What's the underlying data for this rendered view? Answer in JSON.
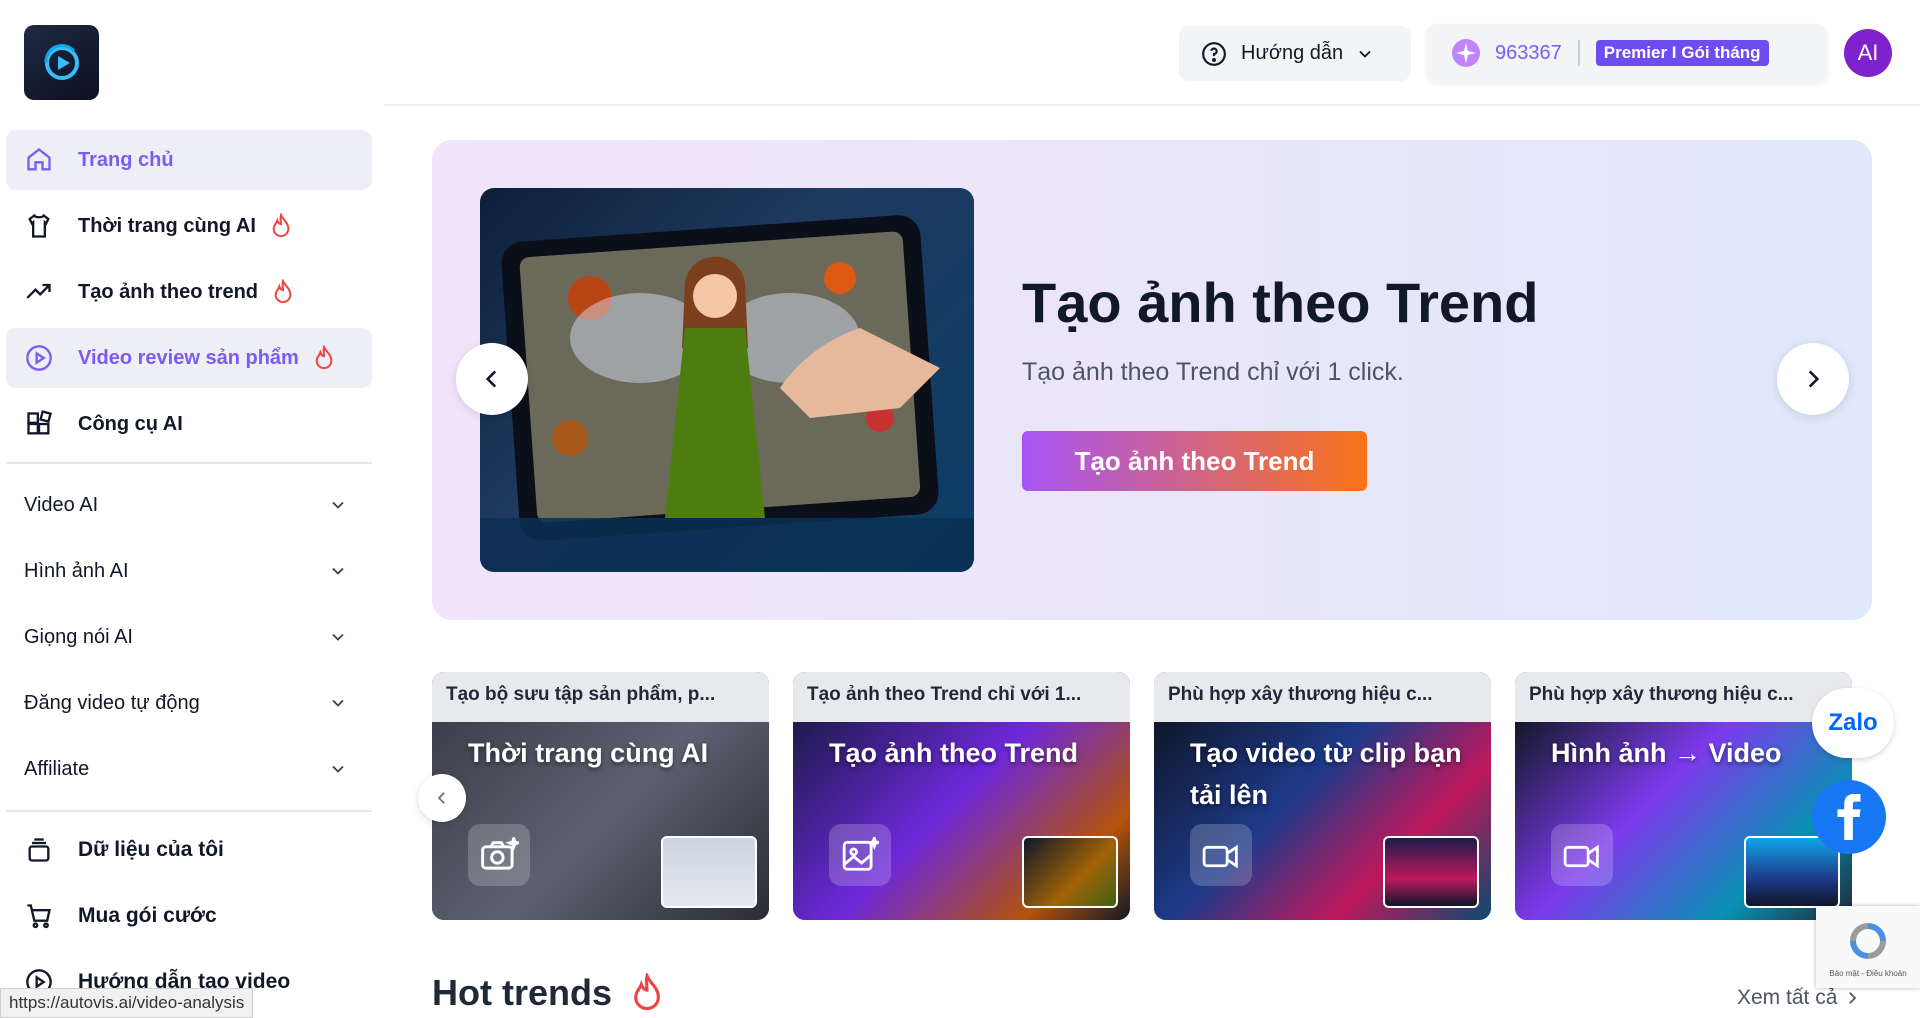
{
  "sidebar": {
    "nav": [
      {
        "label": "Trang chủ",
        "icon": "home-icon",
        "active": true
      },
      {
        "label": "Thời trang cùng AI",
        "icon": "shirt-icon",
        "hot": true
      },
      {
        "label": "Tạo ảnh theo trend",
        "icon": "trend-icon",
        "hot": true
      },
      {
        "label": "Video review sản phẩm",
        "icon": "play-circle-icon",
        "hot": true,
        "active": true
      },
      {
        "label": "Công cụ AI",
        "icon": "tools-icon"
      }
    ],
    "groups": [
      "Video AI",
      "Hình ảnh AI",
      "Giọng nói AI",
      "Đăng video tự động",
      "Affiliate"
    ],
    "bottom": [
      {
        "label": "Dữ liệu của tôi",
        "icon": "layers-icon"
      },
      {
        "label": "Mua gói cước",
        "icon": "cart-icon"
      },
      {
        "label": "Hướng dẫn tạo video",
        "icon": "play-circle-icon"
      }
    ]
  },
  "header": {
    "guide_label": "Hướng dẫn",
    "credits": "963367",
    "plan": "Premier  I  Gói tháng",
    "avatar": "AI"
  },
  "hero": {
    "title": "Tạo ảnh theo Trend",
    "subtitle": "Tạo ảnh theo Trend chỉ với 1 click.",
    "cta": "Tạo ảnh theo Trend"
  },
  "cards": [
    {
      "caption": "Tạo bộ sưu tập sản phẩm, p...",
      "title": "Thời trang cùng AI",
      "icon": "camera-sparkle-icon"
    },
    {
      "caption": "Tạo ảnh theo Trend chỉ với 1...",
      "title": "Tạo ảnh theo Trend",
      "icon": "image-sparkle-icon"
    },
    {
      "caption": "Phù hợp xây thương hiệu c...",
      "title": "Tạo video từ clip bạn tải lên",
      "icon": "video-icon"
    },
    {
      "caption": "Phù hợp xây thương hiệu c...",
      "title": "Hình ảnh → Video",
      "icon": "video-icon"
    }
  ],
  "hot_trends": {
    "title": "Hot trends",
    "see_all": "Xem tất cả"
  },
  "floating": {
    "zalo": "Zalo",
    "recaptcha": "Bảo mật - Điều khoản"
  },
  "status_url": "https://autovis.ai/video-analysis",
  "colors": {
    "accent": "#7b5cf0",
    "fire": "#ef4444",
    "cta_start": "#a855f7",
    "cta_end": "#f97316"
  }
}
